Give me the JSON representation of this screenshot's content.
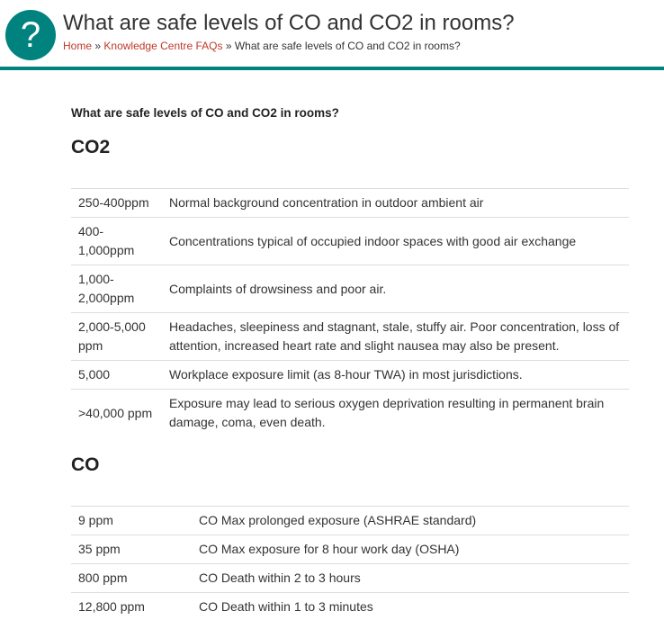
{
  "header": {
    "icon": "question-mark-icon",
    "icon_glyph": "?",
    "title": "What are safe levels of CO and CO2 in rooms?",
    "breadcrumb": {
      "home": "Home",
      "sep": "»",
      "section": "Knowledge Centre FAQs",
      "current": "What are safe levels of CO and CO2 in rooms?"
    },
    "accent_color": "#00837f",
    "link_color": "#c0392b"
  },
  "main": {
    "subtitle": "What are safe levels of CO and CO2 in rooms?",
    "co2": {
      "heading": "CO2",
      "rows": [
        {
          "level": "250-400ppm",
          "desc": "Normal background concentration in outdoor ambient air"
        },
        {
          "level": "400-\n1,000ppm",
          "desc": "Concentrations typical of occupied indoor spaces with good air exchange"
        },
        {
          "level": "1,000-\n2,000ppm",
          "desc": "Complaints of drowsiness and poor air."
        },
        {
          "level": "2,000-5,000\nppm",
          "desc": "Headaches, sleepiness and stagnant, stale, stuffy air. Poor concentration, loss of attention, increased heart rate and slight nausea may also be present."
        },
        {
          "level": "5,000",
          "desc": "Workplace exposure limit (as 8-hour TWA) in most jurisdictions."
        },
        {
          "level": ">40,000 ppm",
          "desc": "Exposure may lead to serious oxygen deprivation resulting in permanent brain damage, coma, even death."
        }
      ]
    },
    "co": {
      "heading": "CO",
      "rows": [
        {
          "level": "9 ppm",
          "desc": "CO Max prolonged exposure (ASHRAE standard)"
        },
        {
          "level": "35 ppm",
          "desc": "CO Max exposure for 8 hour work day (OSHA)"
        },
        {
          "level": "800 ppm",
          "desc": "CO Death within 2 to 3 hours"
        },
        {
          "level": "12,800 ppm",
          "desc": "CO Death within 1 to 3 minutes"
        }
      ]
    }
  }
}
